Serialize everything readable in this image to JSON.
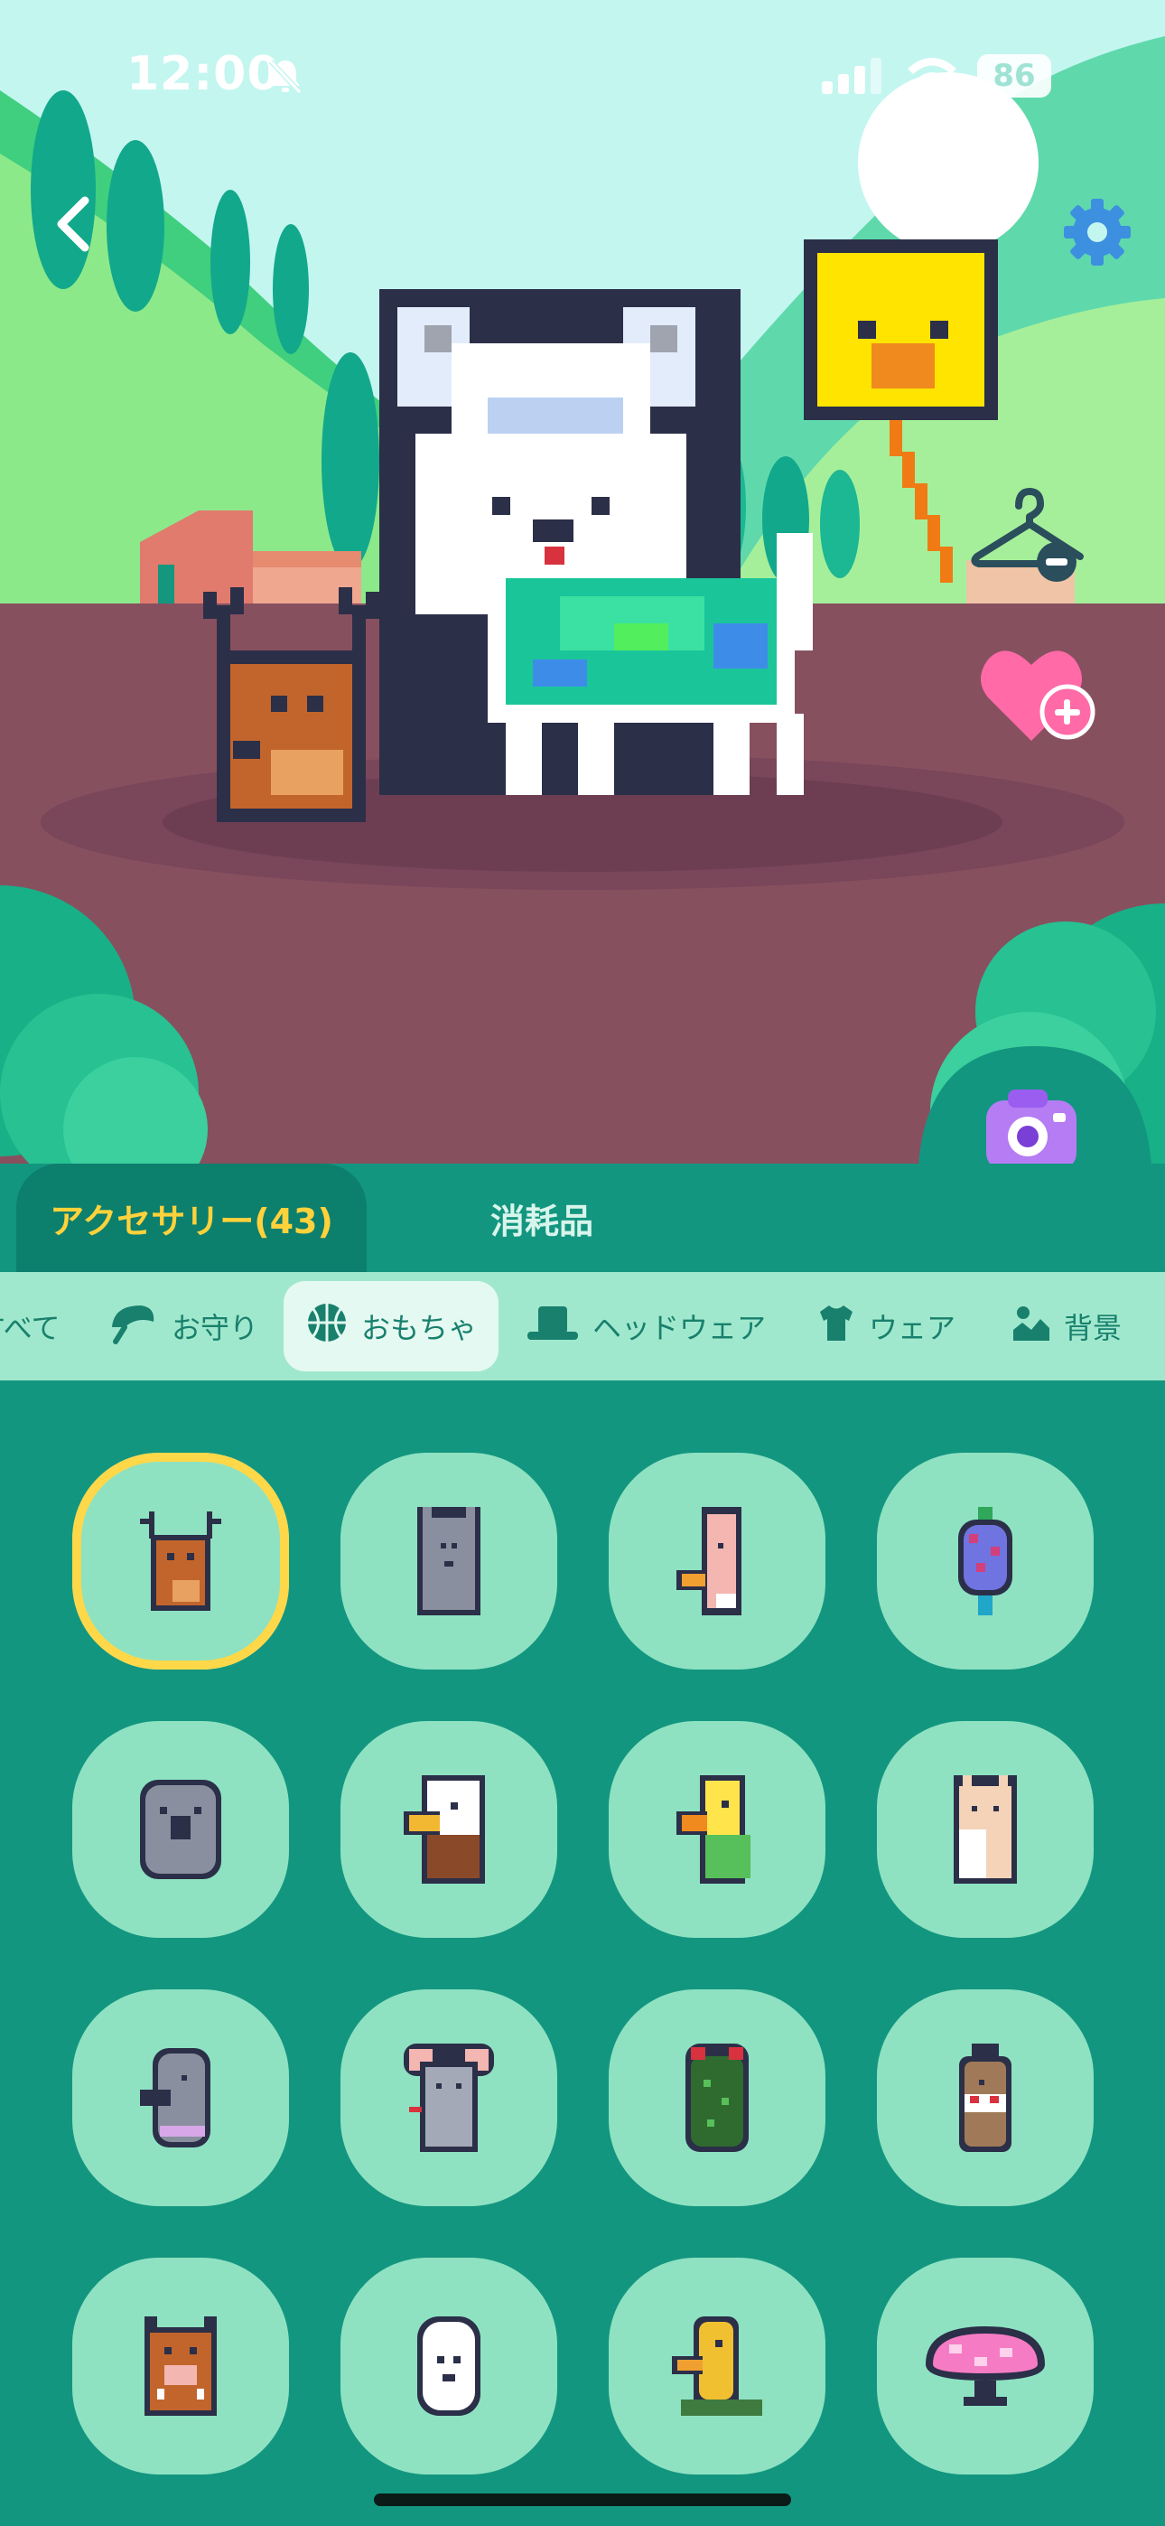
{
  "status_bar": {
    "time": "12:00",
    "battery": "86"
  },
  "scene": {
    "back_icon": "chevron-left-icon",
    "settings_icon": "gear-icon",
    "remove_outfit_icon": "hanger-minus-icon",
    "favorite_icon": "heart-plus-icon",
    "camera_icon": "camera-icon"
  },
  "tabs": [
    {
      "label": "アクセサリー(43)",
      "active": true
    },
    {
      "label": "消耗品",
      "active": false
    }
  ],
  "categories": [
    {
      "label": "すべて",
      "icon": "none",
      "active": false
    },
    {
      "label": "お守り",
      "icon": "umbrella-leaf-icon",
      "active": false
    },
    {
      "label": "おもちゃ",
      "icon": "basketball-icon",
      "active": true
    },
    {
      "label": "ヘッドウェア",
      "icon": "hat-icon",
      "active": false
    },
    {
      "label": "ウェア",
      "icon": "shirt-icon",
      "active": false
    },
    {
      "label": "背景",
      "icon": "landscape-icon",
      "active": false
    }
  ],
  "items": [
    {
      "name": "deer-toy",
      "selected": true
    },
    {
      "name": "gray-box-toy",
      "selected": false
    },
    {
      "name": "pink-bird-toy",
      "selected": false
    },
    {
      "name": "lantern-toy",
      "selected": false
    },
    {
      "name": "koala-toy",
      "selected": false
    },
    {
      "name": "eagle-toy",
      "selected": false
    },
    {
      "name": "yellow-parrot-toy",
      "selected": false
    },
    {
      "name": "alpaca-toy",
      "selected": false
    },
    {
      "name": "seal-toy",
      "selected": false
    },
    {
      "name": "mouse-toy",
      "selected": false
    },
    {
      "name": "beetle-toy",
      "selected": false
    },
    {
      "name": "kokeshi-toy",
      "selected": false
    },
    {
      "name": "boar-toy",
      "selected": false
    },
    {
      "name": "ghost-toy",
      "selected": false
    },
    {
      "name": "duck-toy",
      "selected": false
    },
    {
      "name": "pink-mushroom-toy",
      "selected": false
    }
  ],
  "colors": {
    "accent": "#ffd23c",
    "panel": "#13967f",
    "tile": "#8ee2c2",
    "category_bar": "#a0e8cd"
  }
}
